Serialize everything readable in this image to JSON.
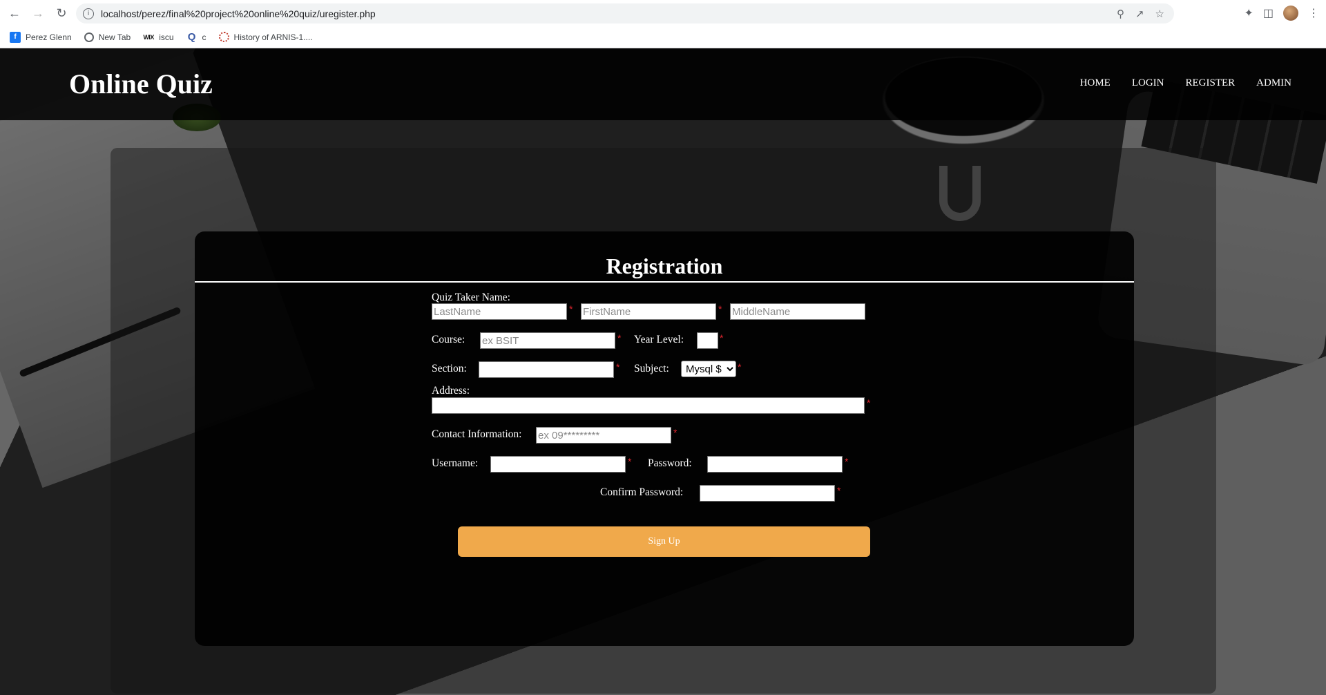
{
  "browser": {
    "url": "localhost/perez/final%20project%20online%20quiz/uregister.php",
    "bookmarks": [
      {
        "label": "Perez Glenn",
        "icon": "facebook-icon"
      },
      {
        "label": "New Tab",
        "icon": "globe-icon"
      },
      {
        "label": "iscu",
        "icon": "wix-icon",
        "icon_text": "WIX"
      },
      {
        "label": "c",
        "icon": "q-icon"
      },
      {
        "label": "History of ARNIS-1....",
        "icon": "ring-icon"
      }
    ]
  },
  "site": {
    "brand": "Online Quiz",
    "nav": [
      "HOME",
      "LOGIN",
      "REGISTER",
      "ADMIN"
    ]
  },
  "form": {
    "title": "Registration",
    "name_label": "Quiz Taker Name:",
    "lastname_placeholder": "LastName",
    "firstname_placeholder": "FirstName",
    "middlename_placeholder": "MiddleName",
    "course_label": "Course:",
    "course_placeholder": "ex BSIT",
    "year_label": "Year Level:",
    "section_label": "Section:",
    "subject_label": "Subject:",
    "subject_selected": "Mysql $",
    "address_label": "Address:",
    "contact_label": "Contact Information:",
    "contact_placeholder": "ex 09*********",
    "username_label": "Username:",
    "password_label": "Password:",
    "confirm_label": "Confirm Password:",
    "required_mark": "*",
    "signup_label": "Sign Up",
    "accent_color": "#f0a94b",
    "required_color": "#e2262f"
  }
}
